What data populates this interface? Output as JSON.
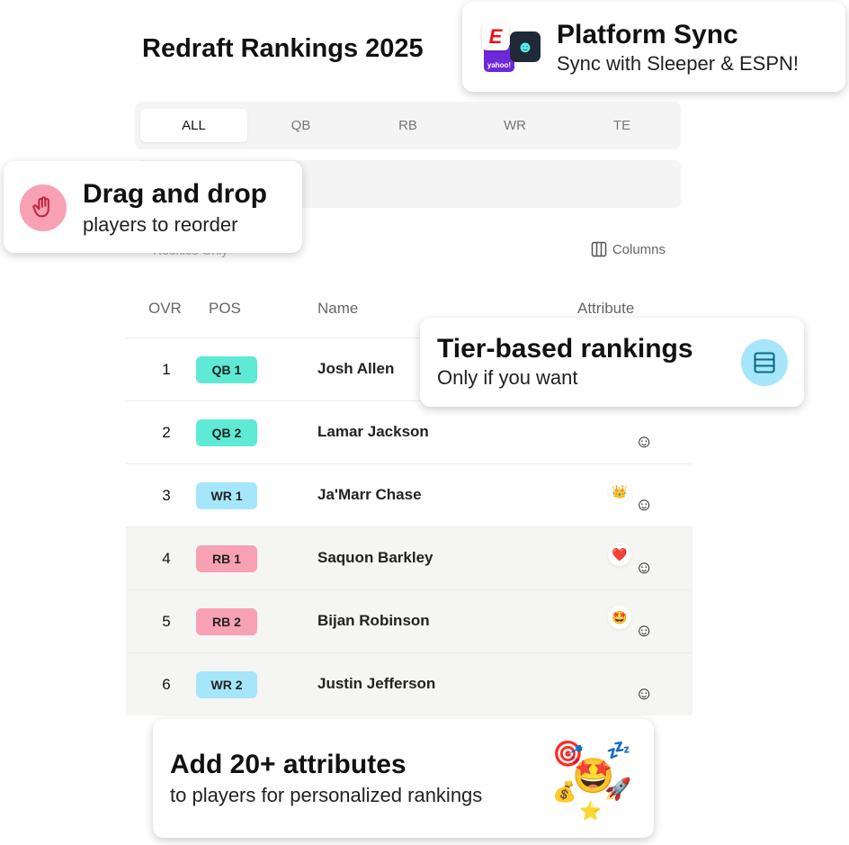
{
  "page": {
    "title": "Redraft Rankings 2025"
  },
  "tabs": [
    {
      "label": "ALL",
      "active": true
    },
    {
      "label": "QB"
    },
    {
      "label": "RB"
    },
    {
      "label": "WR"
    },
    {
      "label": "TE"
    }
  ],
  "filters": {
    "rookies_label": "Rookies Only",
    "columns_label": "Columns"
  },
  "table": {
    "headers": {
      "ovr": "OVR",
      "pos": "POS",
      "name": "Name",
      "attribute": "Attribute"
    },
    "rows": [
      {
        "ovr": "1",
        "pos": "QB 1",
        "name": "Josh Allen",
        "pos_color": "#5eead4",
        "attribute": ""
      },
      {
        "ovr": "2",
        "pos": "QB 2",
        "name": "Lamar Jackson",
        "pos_color": "#5eead4",
        "attribute": ""
      },
      {
        "ovr": "3",
        "pos": "WR 1",
        "name": "Ja'Marr Chase",
        "pos_color": "#a5e6fb",
        "attribute": "👑"
      },
      {
        "ovr": "4",
        "pos": "RB 1",
        "name": "Saquon Barkley",
        "pos_color": "#f7a1b3",
        "attribute": "❤️"
      },
      {
        "ovr": "5",
        "pos": "RB 2",
        "name": "Bijan Robinson",
        "pos_color": "#f7a1b3",
        "attribute": "🤩"
      },
      {
        "ovr": "6",
        "pos": "WR 2",
        "name": "Justin Jefferson",
        "pos_color": "#a5e6fb",
        "attribute": ""
      }
    ]
  },
  "callouts": {
    "sync": {
      "title": "Platform Sync",
      "subtitle": "Sync with Sleeper & ESPN!",
      "logos": [
        "ESPN",
        "yahoo!",
        "Sleeper"
      ]
    },
    "drag": {
      "title": "Drag and drop",
      "subtitle": "players to reorder",
      "icon": "hand-icon"
    },
    "tier": {
      "title": "Tier-based rankings",
      "subtitle": "Only if you want",
      "icon": "rows-icon"
    },
    "attributes": {
      "title": "Add 20+ attributes",
      "subtitle": "to players for personalized rankings",
      "emojis": [
        "🎯",
        "💤",
        "🤩",
        "💰",
        "🚀",
        "⭐"
      ]
    }
  }
}
